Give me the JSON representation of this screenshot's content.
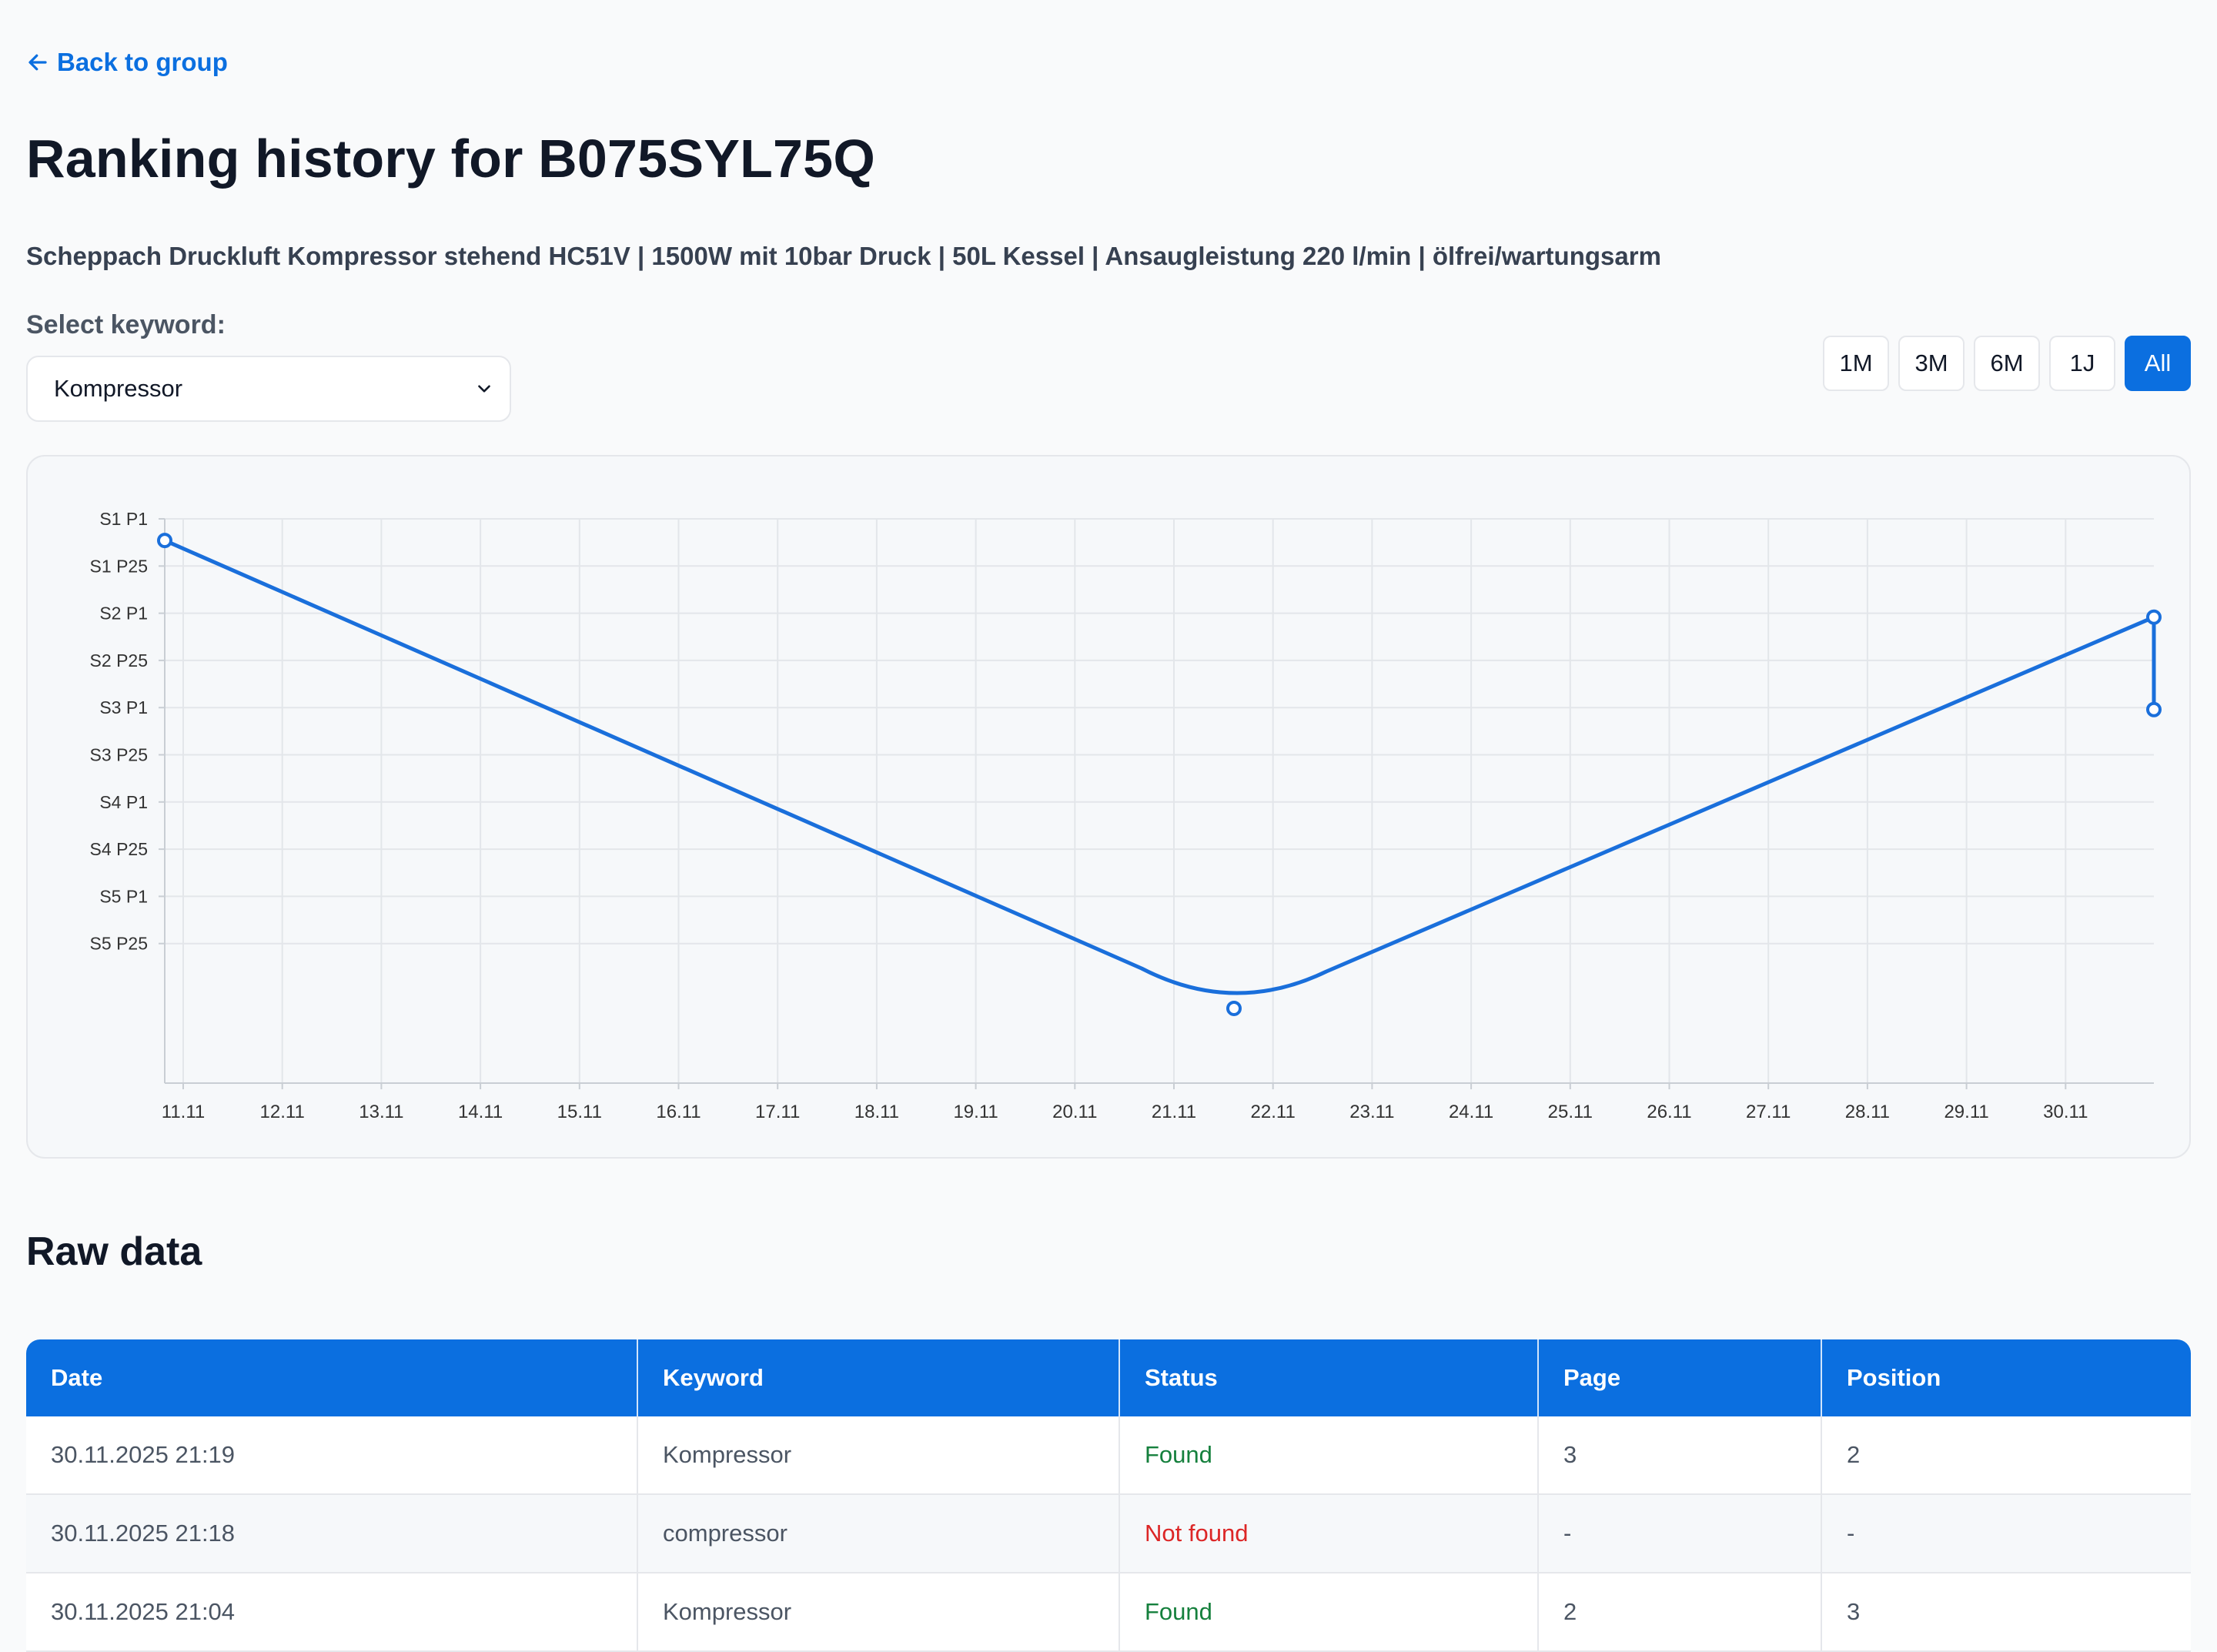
{
  "nav": {
    "back_label": "Back to group"
  },
  "header": {
    "title": "Ranking history for B075SYL75Q",
    "subtitle": "Scheppach Druckluft Kompressor stehend HC51V | 1500W mit 10bar Druck | 50L Kessel | Ansaugleistung 220 l/min | ölfrei/wartungsarm"
  },
  "keyword_select": {
    "label": "Select keyword:",
    "value": "Kompressor"
  },
  "ranges": [
    {
      "label": "1M",
      "active": false
    },
    {
      "label": "3M",
      "active": false
    },
    {
      "label": "6M",
      "active": false
    },
    {
      "label": "1J",
      "active": false
    },
    {
      "label": "All",
      "active": true
    }
  ],
  "chart_data": {
    "type": "line",
    "y_reversed": true,
    "y_ticks": [
      "S1 P1",
      "S1 P25",
      "S2 P1",
      "S2 P25",
      "S3 P1",
      "S3 P25",
      "S4 P1",
      "S4 P25",
      "S5 P1",
      "S5 P25"
    ],
    "x_ticks": [
      "11.11",
      "12.11",
      "13.11",
      "14.11",
      "15.11",
      "16.11",
      "17.11",
      "18.11",
      "19.11",
      "20.11",
      "21.11",
      "22.11",
      "23.11",
      "24.11",
      "25.11",
      "26.11",
      "27.11",
      "28.11",
      "29.11",
      "30.11"
    ],
    "series": [
      {
        "points": [
          {
            "date": "10.11",
            "page": 1,
            "position": 12
          },
          {
            "date": "21.11",
            "page": 6,
            "position": 10
          },
          {
            "date": "30.11",
            "page": 2,
            "position": 3
          },
          {
            "date": "30.11",
            "page": 3,
            "position": 2
          }
        ]
      }
    ],
    "grid": true,
    "color": "#1a6fdb"
  },
  "raw": {
    "title": "Raw data",
    "columns": [
      "Date",
      "Keyword",
      "Status",
      "Page",
      "Position"
    ],
    "rows": [
      {
        "date": "30.11.2025 21:19",
        "keyword": "Kompressor",
        "status": "Found",
        "page": "3",
        "position": "2"
      },
      {
        "date": "30.11.2025 21:18",
        "keyword": "compressor",
        "status": "Not found",
        "page": "-",
        "position": "-"
      },
      {
        "date": "30.11.2025 21:04",
        "keyword": "Kompressor",
        "status": "Found",
        "page": "2",
        "position": "3"
      }
    ]
  }
}
